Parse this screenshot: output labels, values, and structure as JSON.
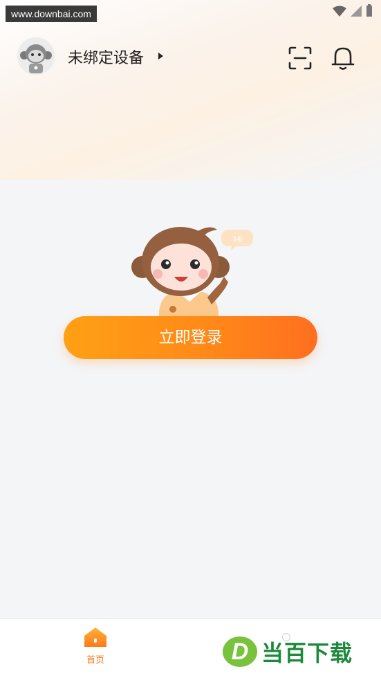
{
  "watermark": "www.downbai.com",
  "header": {
    "device_title": "未绑定设备"
  },
  "mascot": {
    "speech": "Hi"
  },
  "login_button": "立即登录",
  "bottom_nav": {
    "home_label": "首页"
  },
  "brand": {
    "letter": "D",
    "name": "当百下载"
  },
  "colors": {
    "accent": "#ff8a18",
    "brand_green": "#1d8a3b"
  }
}
